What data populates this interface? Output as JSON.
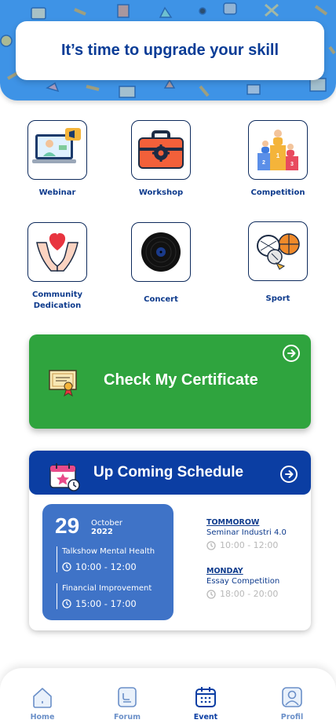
{
  "hero": {
    "title": "It’s time to upgrade your skill",
    "bg_color": "#3e93e6"
  },
  "categories": [
    {
      "label": "Webinar",
      "icon": "laptop-megaphone-icon"
    },
    {
      "label": "Workshop",
      "icon": "toolbox-gear-icon"
    },
    {
      "label": "Competition",
      "icon": "podium-icon"
    },
    {
      "label": "Community\nDedication",
      "line1": "Community",
      "line2": "Dedication",
      "icon": "hands-heart-icon"
    },
    {
      "label": "Concert",
      "icon": "vinyl-record-icon"
    },
    {
      "label": "Sport",
      "icon": "sports-balls-icon"
    }
  ],
  "certificate": {
    "title": "Check My Certificate",
    "color": "#2fa43e"
  },
  "schedule": {
    "title": "Up Coming Schedule",
    "header_color": "#0b3ea3",
    "today": {
      "day": "29",
      "month": "October",
      "year": "2022",
      "events": [
        {
          "name": "Talkshow Mental Health",
          "time": "10:00 - 12:00"
        },
        {
          "name": "Financial Improvement",
          "time": "15:00 - 17:00"
        }
      ]
    },
    "upcoming": [
      {
        "when": "TOMMOROW",
        "name": "Seminar Industri 4.0",
        "time": "10:00 - 12:00"
      },
      {
        "when": "MONDAY",
        "name": "Essay Competition",
        "time": "18:00 - 20:00"
      }
    ]
  },
  "nav": {
    "items": [
      {
        "label": "Home",
        "icon": "home-icon",
        "active": false
      },
      {
        "label": "Forum",
        "icon": "forum-icon",
        "active": false
      },
      {
        "label": "Event",
        "icon": "calendar-icon",
        "active": true
      },
      {
        "label": "Profil",
        "icon": "profile-icon",
        "active": false
      }
    ]
  }
}
